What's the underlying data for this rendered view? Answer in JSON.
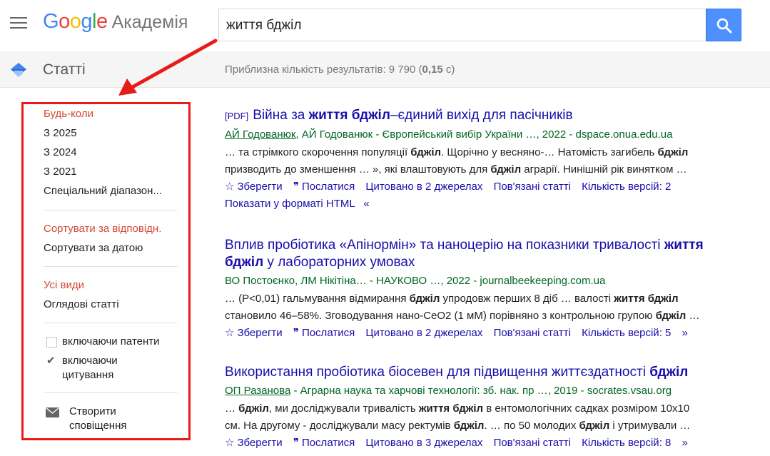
{
  "header": {
    "logo_google": [
      "G",
      "o",
      "o",
      "g",
      "l",
      "e"
    ],
    "logo_product": "Академія",
    "search_value": "життя бджіл"
  },
  "subheader": {
    "title": "Статті",
    "stats_prefix": "Приблизна кількість результатів: 9 790 (",
    "stats_time": "0,15",
    "stats_suffix": " с)"
  },
  "sidebar": {
    "time": {
      "any": "Будь-коли",
      "since_2025": "З 2025",
      "since_2024": "З 2024",
      "since_2021": "З 2021",
      "custom": "Спеціальний діапазон..."
    },
    "sort": {
      "relevance": "Сортувати за відповідн.",
      "date": "Сортувати за датою"
    },
    "type": {
      "all": "Усі види",
      "review": "Оглядові статті"
    },
    "include_patents": "включаючи патенти",
    "include_citations_l1": "включаючи",
    "include_citations_l2": "цитування",
    "create_alert_l1": "Створити",
    "create_alert_l2": "сповіщення"
  },
  "results": [
    {
      "pdf": "[PDF]",
      "title_a": "Війна за ",
      "title_b": "життя бджіл",
      "title_c": "–єдиний вихід для пасічників",
      "author1": "АЙ Годованюк",
      "authors_rest": ", АЙ Годованюк - Європейський вибір України …, 2022 - dspace.onua.edu.ua",
      "snippet": [
        [
          "… та стрімкого скорочення популяції ",
          "бджіл",
          ". Щорічно у весняно-… Натомість загибель ",
          "бджіл",
          ""
        ],
        [
          "призводить до зменшення … », які влаштовують для ",
          "бджіл",
          " аграрії. Нинішній рік винятком …",
          "",
          ""
        ]
      ],
      "save": "Зберегти",
      "cite": "Послатися",
      "cited_by": "Цитовано в 2 джерелах",
      "related": "Пов'язані статті",
      "versions": "Кількість версій: 2",
      "html_view": "Показати у форматі HTML"
    },
    {
      "title_a": "Вплив пробіотика «Апінормін» та наноцерію на показники тривалості ",
      "title_b": "життя",
      "title_c": "бджіл",
      "title_d": " у лабораторних умовах",
      "authors": "ВО Постоєнко, ЛМ Нікітіна… - НАУКОВО …, 2022 - journalbeekeeping.com.ua",
      "snippet": [
        [
          "… (P<0,01) гальмування відмирання ",
          "бджіл",
          " упродовж перших 8 діб … валості ",
          "життя бджіл",
          ""
        ],
        [
          "становило 46–58%. Зговодування нано-CeO2 (1 мМ) порівняно з контрольною групою ",
          "бджіл",
          " …",
          "",
          ""
        ]
      ],
      "save": "Зберегти",
      "cite": "Послатися",
      "cited_by": "Цитовано в 2 джерелах",
      "related": "Пов'язані статті",
      "versions": "Кількість версій: 5"
    },
    {
      "title_a": "Використання пробіотика біосевен для підвищення життєздатності ",
      "title_b": "бджіл",
      "author1": "ОП Разанова",
      "authors_rest": " - Аграрна наука та харчові технології: зб. нак. пр …, 2019 - socrates.vsau.org",
      "snippet": [
        [
          "… ",
          "бджіл",
          ", ми досліджували тривалість ",
          "життя бджіл",
          " в ентомологічних садках розміром 10х10"
        ],
        [
          "см. На другому - досліджували масу ректумів ",
          "бджіл",
          ". … по 50 молодих ",
          "бджіл",
          " і утримували …"
        ]
      ],
      "save": "Зберегти",
      "cite": "Послатися",
      "cited_by": "Цитовано в 3 джерелах",
      "related": "Пов'язані статті",
      "versions": "Кількість версій: 8"
    }
  ],
  "colors": {
    "accent_blue": "#4d90fe",
    "link": "#1a0dab",
    "author_green": "#006621",
    "active_red": "#d14836",
    "annotation_red": "#e81b1b"
  }
}
